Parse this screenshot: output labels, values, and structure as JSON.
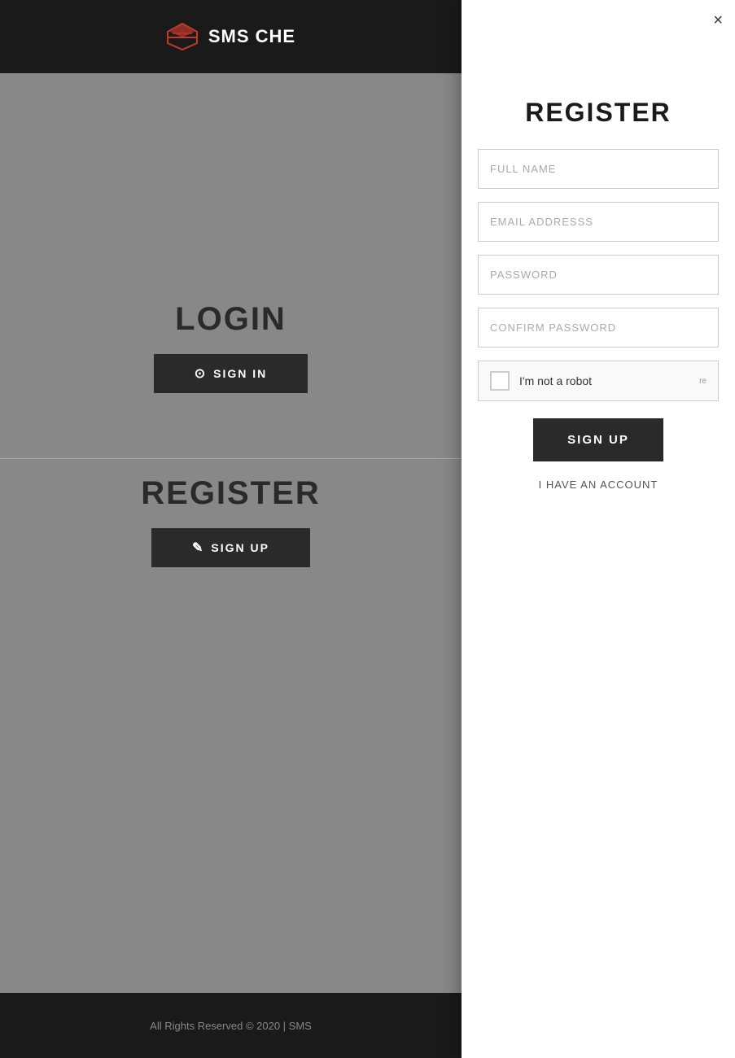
{
  "header": {
    "brand": "SMS CHE",
    "logo_alt": "SMS Checker Logo"
  },
  "background": {
    "login_title": "LOGIN",
    "sign_in_label": "SIGN IN",
    "register_title": "REGISTER",
    "sign_up_label": "SIGN UP"
  },
  "footer": {
    "copyright": "All Rights Reserved © 2020 | SMS"
  },
  "modal": {
    "close_label": "×",
    "title": "REGISTER",
    "full_name_placeholder": "FULL NAME",
    "email_placeholder": "EMAIL ADDRESSS",
    "password_placeholder": "PASSWORD",
    "confirm_password_placeholder": "CONFIRM PASSWORD",
    "recaptcha_label": "I'm not a robot",
    "recaptcha_suffix": "re",
    "signup_button": "SIGN UP",
    "have_account": "I HAVE AN ACCOUNT"
  },
  "icons": {
    "user_icon": "⊙",
    "pencil_icon": "✎",
    "close_icon": "×"
  }
}
